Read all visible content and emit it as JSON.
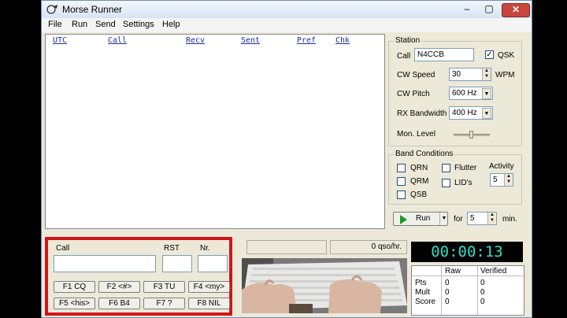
{
  "window": {
    "title": "Morse Runner"
  },
  "titlebar_buttons": {
    "minimize": "–",
    "maximize": "▢",
    "close": "✕"
  },
  "menu": [
    "File",
    "Run",
    "Send",
    "Settings",
    "Help"
  ],
  "log": {
    "columns": [
      "UTC",
      "Call",
      "Recv",
      "Sent",
      "Pref",
      "Chk"
    ]
  },
  "station": {
    "title": "Station",
    "call_label": "Call",
    "call_value": "N4CCB",
    "qsk_label": "QSK",
    "qsk_checked": true,
    "cw_speed_label": "CW Speed",
    "cw_speed_value": "30",
    "wpm_label": "WPM",
    "cw_pitch_label": "CW Pitch",
    "cw_pitch_value": "600 Hz",
    "rx_bw_label": "RX Bandwidth",
    "rx_bw_value": "400 Hz",
    "mon_level_label": "Mon. Level"
  },
  "band": {
    "title": "Band Conditions",
    "qrn": "QRN",
    "qrm": "QRM",
    "qsb": "QSB",
    "flutter": "Flutter",
    "lids": "LID's",
    "activity_label": "Activity",
    "activity_value": "5"
  },
  "run": {
    "button": "Run",
    "for_label": "for",
    "minutes": "5",
    "min_label": "min."
  },
  "entry": {
    "call_label": "Call",
    "rst_label": "RST",
    "nr_label": "Nr.",
    "call_value": "",
    "rst_value": "",
    "nr_value": "",
    "fkeys": [
      "F1  CQ",
      "F2  <#>",
      "F3  TU",
      "F4  <my>",
      "F5  <his>",
      "F6  B4",
      "F7  ?",
      "F8  NIL"
    ]
  },
  "status": {
    "rate": "0 qso/hr."
  },
  "timer": "00:00:13",
  "score": {
    "col_raw": "Raw",
    "col_verified": "Verified",
    "rows": [
      {
        "label": "Pts",
        "raw": "0",
        "verified": "0"
      },
      {
        "label": "Mult",
        "raw": "0",
        "verified": "0"
      },
      {
        "label": "Score",
        "raw": "0",
        "verified": "0"
      }
    ]
  },
  "colors": {
    "timer_fg": "#2fe0c6",
    "highlight": "#d0151a",
    "log_header": "#1a2fa5"
  }
}
